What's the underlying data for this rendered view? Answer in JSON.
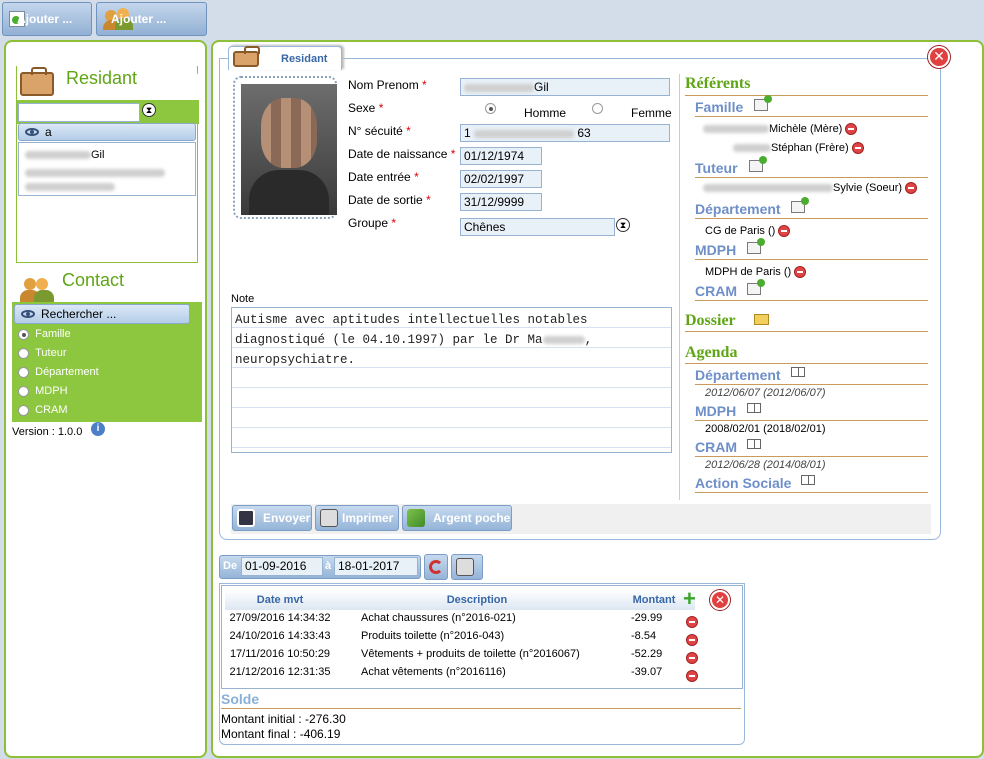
{
  "toolbar": {
    "add_resident": "Ajouter ...",
    "add_contact": "Ajouter ..."
  },
  "left": {
    "resident_title": "Residant",
    "resident_search_value": "",
    "filter_label": "a",
    "resident_list": [
      "Gil"
    ],
    "contact_title": "Contact",
    "search_label": "Rechercher ...",
    "contact_filters": [
      {
        "label": "Famille",
        "selected": true
      },
      {
        "label": "Tuteur",
        "selected": false
      },
      {
        "label": "Département",
        "selected": false
      },
      {
        "label": "MDPH",
        "selected": false
      },
      {
        "label": "CRAM",
        "selected": false
      }
    ],
    "version": "Version : 1.0.0"
  },
  "resident": {
    "tab_label": "Residant",
    "labels": {
      "name": "Nom Prenom",
      "sex": "Sexe",
      "ssn": "N° sécuité",
      "birth": "Date de naissance",
      "entry": "Date entrée",
      "exit": "Date de sortie",
      "group": "Groupe",
      "male": "Homme",
      "female": "Femme",
      "note": "Note"
    },
    "required_mark": "*",
    "name_value": "Gil",
    "sex": "Homme",
    "ssn_prefix": "1",
    "ssn_suffix": "63",
    "birth": "01/12/1974",
    "entry": "02/02/1997",
    "exit": "31/12/9999",
    "group": "Chênes",
    "note_lines": [
      "Autisme avec aptitudes intellectuelles notables",
      "diagnostiqué (le 04.10.1997) par le Dr Ma",
      "neuropsychiatre."
    ],
    "note_line2_suffix": ","
  },
  "referents": {
    "title": "Référents",
    "famille_label": "Famille",
    "famille": [
      "Michèle (Mère)",
      "Stéphan (Frère)"
    ],
    "tuteur_label": "Tuteur",
    "tuteur": [
      "Sylvie (Soeur)"
    ],
    "departement_label": "Département",
    "departement": [
      "CG de Paris ()"
    ],
    "mdph_label": "MDPH",
    "mdph": [
      "MDPH de Paris ()"
    ],
    "cram_label": "CRAM"
  },
  "dossier": {
    "title": "Dossier"
  },
  "agenda": {
    "title": "Agenda",
    "departement_label": "Département",
    "departement_date": "2012/06/07 (2012/06/07)",
    "mdph_label": "MDPH",
    "mdph_date": "2008/02/01 (2018/02/01)",
    "cram_label": "CRAM",
    "cram_date": "2012/06/28 (2014/08/01)",
    "action_label": "Action Sociale"
  },
  "actions": {
    "send": "Envoyer",
    "print": "Imprimer",
    "money": "Argent poche"
  },
  "range": {
    "from_label": "De",
    "from": "01-09-2016",
    "to_label": "à",
    "to": "18-01-2017"
  },
  "movements": {
    "headers": [
      "Date mvt",
      "Description",
      "Montant"
    ],
    "rows": [
      {
        "date": "27/09/2016 14:34:32",
        "desc": "Achat chaussures (n°2016-021)",
        "amount": "-29.99"
      },
      {
        "date": "24/10/2016 14:33:43",
        "desc": "Produits toilette (n°2016-043)",
        "amount": "-8.54"
      },
      {
        "date": "17/11/2016 10:50:29",
        "desc": "Vêtements + produits de toilette (n°2016067)",
        "amount": "-52.29"
      },
      {
        "date": "21/12/2016 12:31:35",
        "desc": "Achat vêtements (n°2016116)",
        "amount": "-39.07"
      }
    ]
  },
  "solde": {
    "title": "Solde",
    "initial": "Montant initial : -276.30",
    "final": "Montant final : -406.19"
  }
}
